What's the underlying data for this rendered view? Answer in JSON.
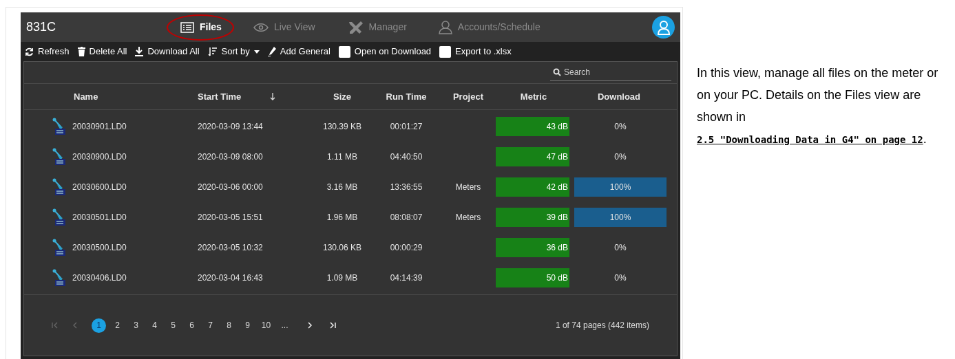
{
  "app": {
    "title": "831C",
    "nav": [
      {
        "label": "Files",
        "selected": true
      },
      {
        "label": "Live View",
        "selected": false
      },
      {
        "label": "Manager",
        "selected": false
      },
      {
        "label": "Accounts/Schedule",
        "selected": false
      }
    ],
    "toolbar": [
      {
        "kind": "button",
        "label": "Refresh"
      },
      {
        "kind": "button",
        "label": "Delete All"
      },
      {
        "kind": "button",
        "label": "Download All"
      },
      {
        "kind": "dropdown",
        "label": "Sort by"
      },
      {
        "kind": "button",
        "label": "Add General"
      },
      {
        "kind": "checkbox",
        "label": "Open on Download",
        "checked": false
      },
      {
        "kind": "checkbox",
        "label": "Export to .xlsx",
        "checked": false
      }
    ],
    "search": {
      "placeholder": "Search"
    },
    "table": {
      "columns": [
        "Name",
        "Start Time",
        "Size",
        "Run Time",
        "Project",
        "Metric",
        "Download"
      ],
      "rows": [
        {
          "name": "20030901.LD0",
          "start_time": "2020-03-09 13:44",
          "size": "130.39 KB",
          "run_time": "00:01:27",
          "project": "",
          "metric": "43 dB",
          "download": "0%",
          "complete": false
        },
        {
          "name": "20030900.LD0",
          "start_time": "2020-03-09 08:00",
          "size": "1.11 MB",
          "run_time": "04:40:50",
          "project": "",
          "metric": "47 dB",
          "download": "0%",
          "complete": false
        },
        {
          "name": "20030600.LD0",
          "start_time": "2020-03-06 00:00",
          "size": "3.16 MB",
          "run_time": "13:36:55",
          "project": "Meters",
          "metric": "42 dB",
          "download": "100%",
          "complete": true
        },
        {
          "name": "20030501.LD0",
          "start_time": "2020-03-05 15:51",
          "size": "1.96 MB",
          "run_time": "08:08:07",
          "project": "Meters",
          "metric": "39 dB",
          "download": "100%",
          "complete": true
        },
        {
          "name": "20030500.LD0",
          "start_time": "2020-03-05 10:32",
          "size": "130.06 KB",
          "run_time": "00:00:29",
          "project": "",
          "metric": "36 dB",
          "download": "0%",
          "complete": false
        },
        {
          "name": "20030406.LD0",
          "start_time": "2020-03-04 16:43",
          "size": "1.09 MB",
          "run_time": "04:14:39",
          "project": "",
          "metric": "50 dB",
          "download": "0%",
          "complete": false
        }
      ]
    },
    "pagination": {
      "pages": [
        {
          "label": "1",
          "selected": true
        },
        {
          "label": "2",
          "selected": false
        },
        {
          "label": "3",
          "selected": false
        },
        {
          "label": "4",
          "selected": false
        },
        {
          "label": "5",
          "selected": false
        },
        {
          "label": "6",
          "selected": false
        },
        {
          "label": "7",
          "selected": false
        },
        {
          "label": "8",
          "selected": false
        },
        {
          "label": "9",
          "selected": false
        },
        {
          "label": "10",
          "selected": false
        },
        {
          "label": "...",
          "selected": false
        }
      ],
      "summary": "1 of 74 pages (442 items)"
    }
  },
  "description": "In this view, manage all files on the meter or on your PC. Details on the Files view are shown in ",
  "link": "2.5 \"Downloading Data in G4\" on page 12",
  "description_end": "."
}
